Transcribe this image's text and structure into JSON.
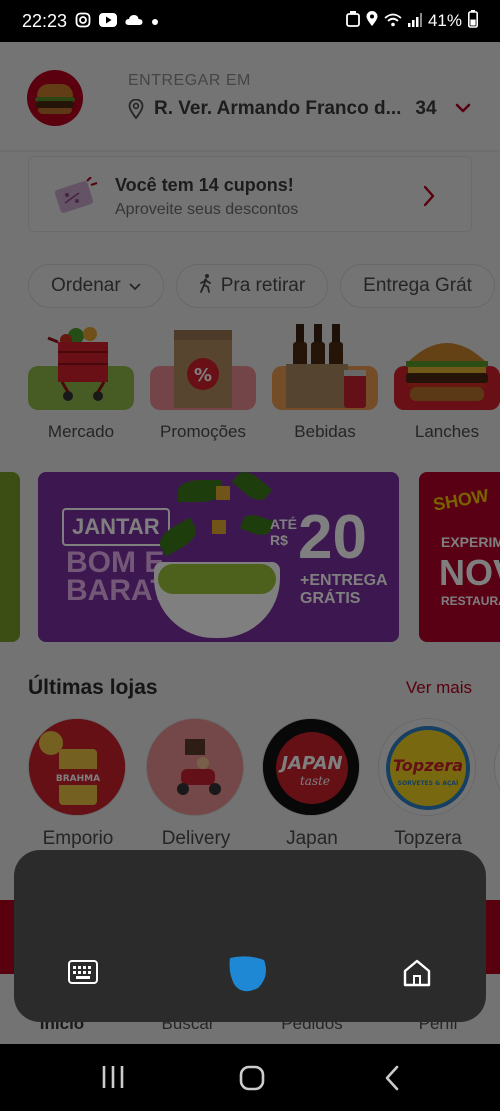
{
  "status_bar": {
    "time": "22:23",
    "left_icons": [
      "instagram-icon",
      "youtube-icon",
      "cloud-icon",
      "dot-icon"
    ],
    "battery": "41%"
  },
  "header": {
    "deliver_label": "ENTREGAR EM",
    "address": "R. Ver. Armando Franco d...",
    "address_number": "34"
  },
  "coupon": {
    "title": "Você tem 14 cupons!",
    "subtitle": "Aproveite seus descontos"
  },
  "chips": [
    {
      "label": "Ordenar"
    },
    {
      "label": "Pra retirar"
    },
    {
      "label": "Entrega Grát"
    }
  ],
  "categories": [
    {
      "label": "Mercado"
    },
    {
      "label": "Promoções"
    },
    {
      "label": "Bebidas"
    },
    {
      "label": "Lanches"
    }
  ],
  "banner_main": {
    "tag": "JANTAR",
    "line1": "BOM E",
    "line2": "BARATO",
    "ate_line1": "ATÉ",
    "ate_line2": "R$",
    "amount": "20",
    "sub1": "+ENTREGA",
    "sub2": "GRÁTIS"
  },
  "banner_next": {
    "show": "SHOW",
    "line1": "EXPERIM",
    "line2": "NOV",
    "line3": "RESTAURA"
  },
  "recent": {
    "title": "Últimas lojas",
    "see_more": "Ver mais",
    "stores": [
      {
        "name": "Emporio",
        "logo_text": "BRAHMA"
      },
      {
        "name": "Delivery"
      },
      {
        "name": "Japan",
        "logo_text1": "JAPAN",
        "logo_text2": "taste"
      },
      {
        "name": "Topzera",
        "logo_text1": "Topzera",
        "logo_text2": "SORVETES & AÇAÍ"
      }
    ]
  },
  "bottom_nav": [
    {
      "label": "Início"
    },
    {
      "label": "Buscar"
    },
    {
      "label": "Pedidos"
    },
    {
      "label": "Perfil"
    }
  ],
  "colors": {
    "brand_red": "#b3001e",
    "overlay_panel": "#2b2b2b",
    "assistant_blue": "#1e88d4"
  }
}
